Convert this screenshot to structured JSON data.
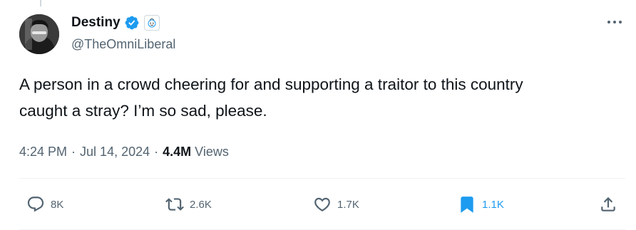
{
  "author": {
    "display_name": "Destiny",
    "handle": "@TheOmniLiberal",
    "verified": true,
    "avatar": "avatar-photo-icon",
    "affiliate_badge": "affiliate-badge-icon"
  },
  "tweet": {
    "text": "A person in a crowd cheering for and supporting a traitor to this country\ncaught a stray? I’m so sad, please.",
    "time": "4:24 PM",
    "separator": "·",
    "date": "Jul 14, 2024",
    "views_count": "4.4M",
    "views_label": "Views"
  },
  "actions": {
    "reply": {
      "icon": "reply-icon",
      "count": "8K"
    },
    "repost": {
      "icon": "repost-icon",
      "count": "2.6K"
    },
    "like": {
      "icon": "like-icon",
      "count": "1.7K"
    },
    "bookmark": {
      "icon": "bookmark-icon",
      "count": "1.1K",
      "active": true
    },
    "share": {
      "icon": "share-icon"
    },
    "more": {
      "icon": "more-options-icon"
    }
  },
  "colors": {
    "text_primary": "#0f1419",
    "text_secondary": "#536471",
    "accent": "#1d9bf0",
    "divider": "#eff3f4"
  }
}
